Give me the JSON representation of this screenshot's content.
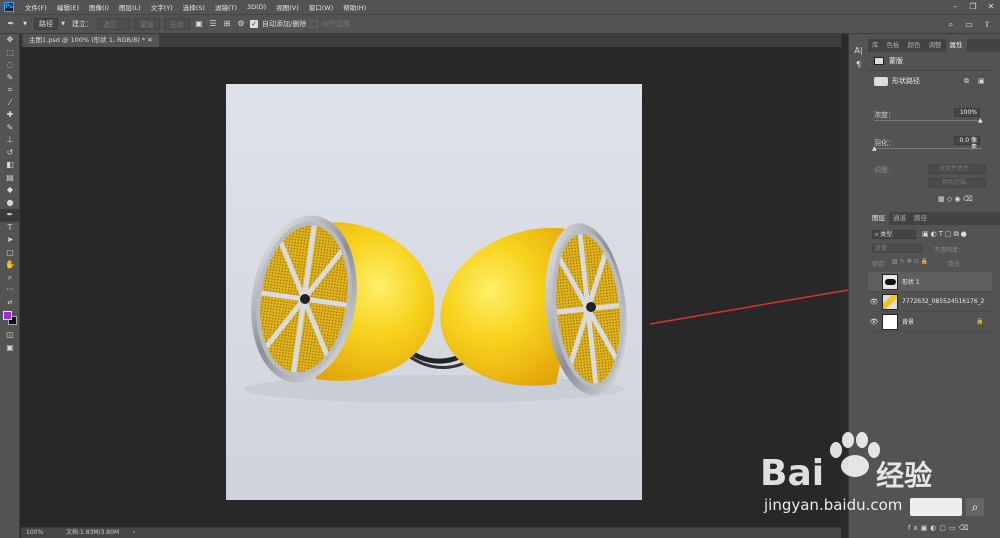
{
  "menubar": {
    "logo": "Ps",
    "items": [
      "文件(F)",
      "编辑(E)",
      "图像(I)",
      "图层(L)",
      "文字(Y)",
      "选择(S)",
      "滤镜(T)",
      "3D(D)",
      "视图(V)",
      "窗口(W)",
      "帮助(H)"
    ]
  },
  "options": {
    "tool_mode": "路径",
    "create_label": "建立：",
    "selection_btn": "选区…",
    "mask_btn": "蒙版",
    "shape_btn": "形状",
    "auto_add": "自动添加/删除",
    "align_edges": "对齐边缘"
  },
  "document": {
    "tab_title": "主图1.psd @ 100% (形状 1, RGB/8) *",
    "zoom": "100%",
    "doc_info": "文档:1.83M/3.80M"
  },
  "properties": {
    "tabs": [
      "库",
      "色板",
      "颜色",
      "调整",
      "属性"
    ],
    "active_tab": "属性",
    "section": "蒙版",
    "mask_type": "形状路径",
    "density_label": "浓度：",
    "density_value": "100%",
    "feather_label": "羽化：",
    "feather_value": "0.0 像素",
    "adjust_label": "调整：",
    "select_subject_btn": "选择并遮住…",
    "color_range_btn": "颜色范围…"
  },
  "layers": {
    "tabs": [
      "图层",
      "通道",
      "路径"
    ],
    "filter_kind": "类型",
    "blend_mode": "正常",
    "opacity_label": "不透明度：",
    "lock_label": "锁定：",
    "fill_label": "填充：",
    "items": [
      {
        "name": "形状 1",
        "selected": true
      },
      {
        "name": "7772632_085524516176_2",
        "selected": false
      },
      {
        "name": "背景",
        "selected": false
      }
    ]
  },
  "watermark": {
    "brand": "Bai",
    "brand2": "经验",
    "url": "jingyan.baidu.com"
  },
  "colors": {
    "accent_arrow": "#d8332f",
    "foreground_swatch": "#a02bd9",
    "background_swatch": "#111111"
  }
}
